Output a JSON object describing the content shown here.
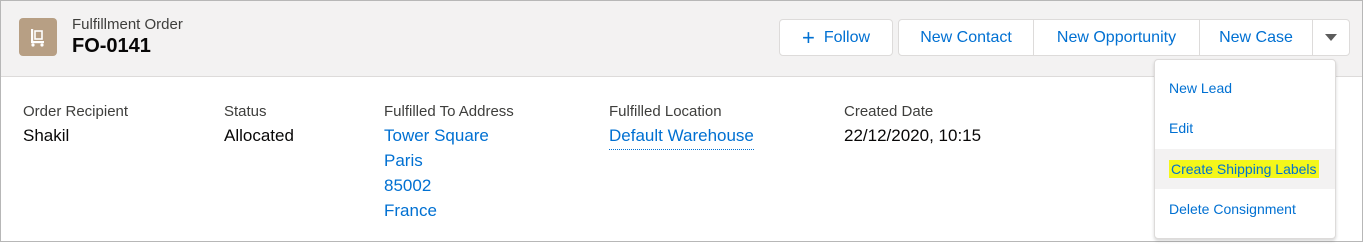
{
  "header": {
    "object_label": "Fulfillment Order",
    "record_name": "FO-0141",
    "icon": "dolly-icon"
  },
  "actions": {
    "follow_label": "Follow",
    "buttons": [
      "New Contact",
      "New Opportunity",
      "New Case"
    ],
    "more_icon": "chevron-down-icon"
  },
  "fields": {
    "order_recipient": {
      "label": "Order Recipient",
      "value": "Shakil"
    },
    "status": {
      "label": "Status",
      "value": "Allocated"
    },
    "fulfilled_to_address": {
      "label": "Fulfilled To Address",
      "lines": [
        "Tower Square",
        "Paris",
        "85002",
        "France"
      ]
    },
    "fulfilled_location": {
      "label": "Fulfilled Location",
      "value": "Default Warehouse"
    },
    "created_date": {
      "label": "Created Date",
      "value": "22/12/2020, 10:15"
    }
  },
  "menu": {
    "items": [
      "New Lead",
      "Edit",
      "Create Shipping Labels",
      "Delete Consignment"
    ],
    "highlighted_item": "Create Shipping Labels"
  },
  "colors": {
    "link": "#0070d2",
    "header_bg": "#f3f2f2",
    "object_icon_bg": "#b79f84",
    "highlight": "#f4f71a"
  }
}
